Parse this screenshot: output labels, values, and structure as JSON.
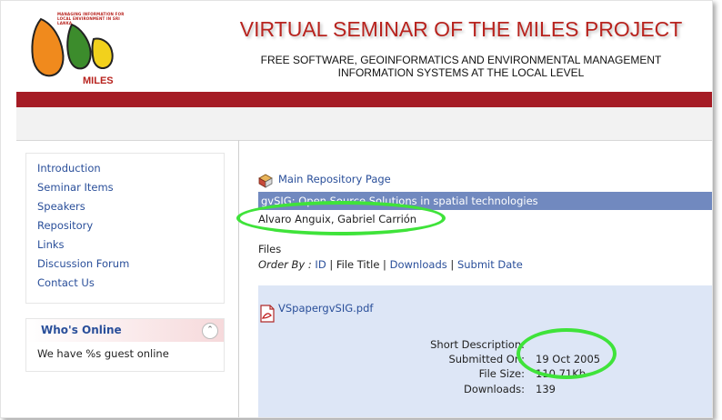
{
  "header": {
    "logo_small_text": "MANAGING INFORMATION FOR LOCAL ENVIRONMENT IN SRI LANKA",
    "logo_name": "MILES",
    "title": "VIRTUAL SEMINAR OF THE MILES PROJECT",
    "subtitle_line1": "FREE SOFTWARE, GEOINFORMATICS AND ENVIRONMENTAL MANAGEMENT",
    "subtitle_line2": "INFORMATION SYSTEMS AT THE LOCAL LEVEL"
  },
  "sidebar": {
    "menu": [
      {
        "label": "Introduction"
      },
      {
        "label": "Seminar Items"
      },
      {
        "label": "Speakers"
      },
      {
        "label": "Repository"
      },
      {
        "label": "Links"
      },
      {
        "label": "Discussion Forum"
      },
      {
        "label": "Contact Us"
      }
    ],
    "whos_online": {
      "title": "Who's Online",
      "text": "We have %s guest online"
    }
  },
  "main": {
    "repo_link": "Main Repository Page",
    "item_title": "gvSIG: Open Source Solutions in spatial technologies",
    "authors": "Alvaro Anguix, Gabriel Carrión",
    "files_heading": "Files",
    "order_by": {
      "label": "Order By :",
      "options": [
        "ID",
        "File Title",
        "Downloads",
        "Submit Date"
      ]
    },
    "file": {
      "name": "VSpapergvSIG.pdf",
      "short_description_label": "Short Description:",
      "submitted_label": "Submitted On:",
      "submitted_value": "19 Oct 2005",
      "size_label": "File Size:",
      "size_value": "110.71Kb",
      "downloads_label": "Downloads:",
      "downloads_value": "139"
    }
  },
  "colors": {
    "brand_red": "#a51c25",
    "link_blue": "#2a4f9a",
    "title_bar": "#7189bf",
    "file_panel": "#dde6f6",
    "highlight_ring": "#3fe33a"
  }
}
